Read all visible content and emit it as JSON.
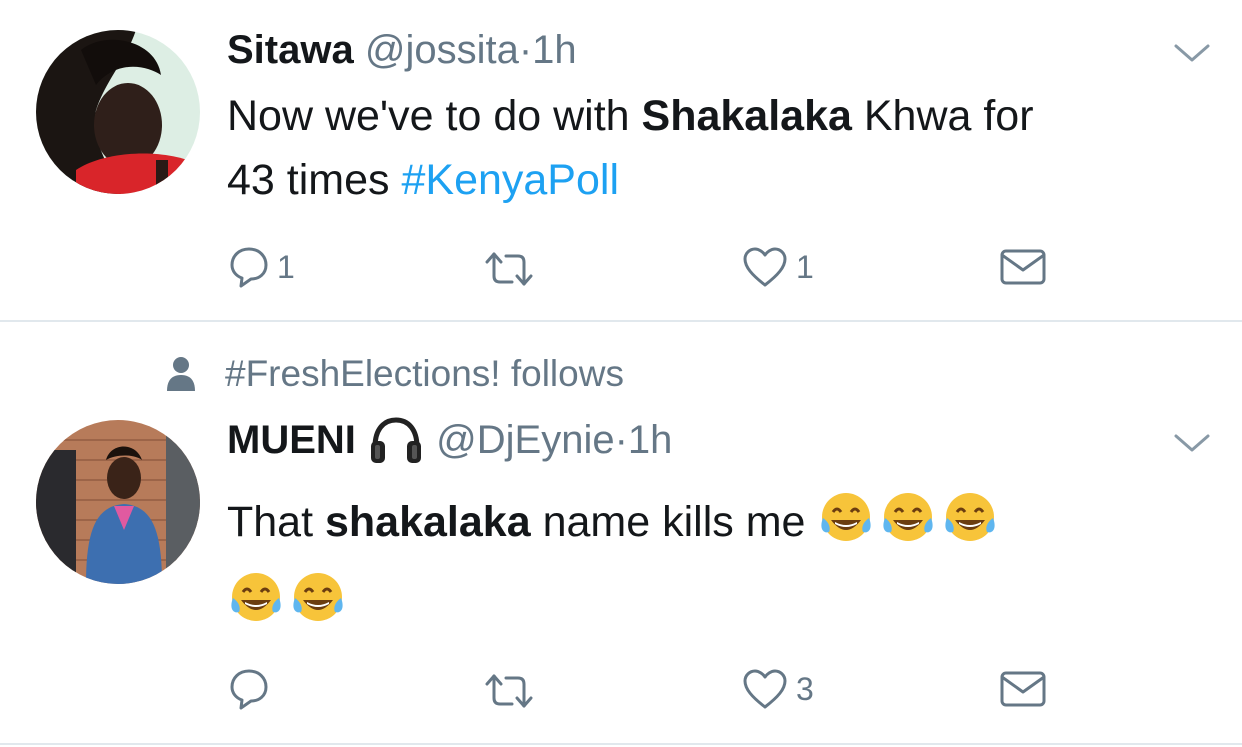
{
  "tweets": [
    {
      "name": "Sitawa",
      "handle": "@jossita",
      "separator": "·",
      "time": "1h",
      "text_parts": {
        "p1": "Now we've to do with ",
        "bold": "Shakalaka",
        "p2": " Khwa for",
        "line2": "43 times ",
        "hashtag": "#KenyaPoll"
      },
      "actions": {
        "reply_count": "1",
        "retweet_count": "",
        "like_count": "1"
      }
    },
    {
      "context": "#FreshElections! follows",
      "name": "MUENI",
      "handle": "@DjEynie",
      "separator": "·",
      "time": "1h",
      "text_parts": {
        "p1": "That ",
        "bold": "shakalaka",
        "p2": " name kills me "
      },
      "emoji_name": "face-with-tears-of-joy",
      "actions": {
        "reply_count": "",
        "retweet_count": "",
        "like_count": "3"
      }
    }
  ],
  "colors": {
    "text": "#14171a",
    "secondary": "#657786",
    "link": "#1da1f2",
    "divider": "#e1e8ed"
  }
}
